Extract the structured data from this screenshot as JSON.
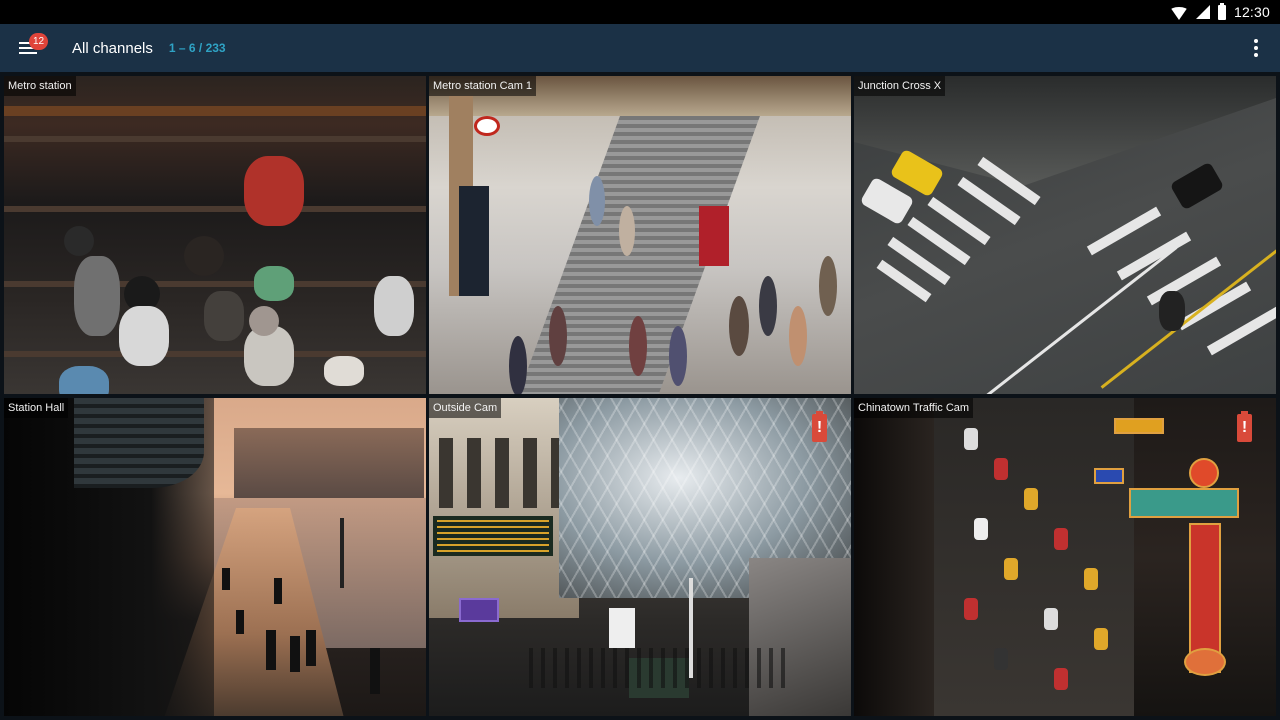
{
  "status_bar": {
    "time": "12:30",
    "icons": [
      "wifi-icon",
      "signal-icon",
      "battery-icon"
    ]
  },
  "app_bar": {
    "menu_badge": "12",
    "title": "All channels",
    "count": "1 – 6 / 233",
    "menu_icon": "hamburger-icon",
    "overflow_icon": "more-vert-icon"
  },
  "channels": [
    {
      "label": "Metro station",
      "low_battery": false
    },
    {
      "label": "Metro station Cam 1",
      "low_battery": false
    },
    {
      "label": "Junction Cross X",
      "low_battery": false
    },
    {
      "label": "Station Hall",
      "low_battery": false
    },
    {
      "label": "Outside Cam",
      "low_battery": true
    },
    {
      "label": "Chinatown Traffic Cam",
      "low_battery": true
    }
  ],
  "low_battery_symbol": "!",
  "colors": {
    "app_bar": "#1b3146",
    "accent": "#2fa3c5",
    "badge": "#e0443a",
    "low_battery": "#d94a3a"
  }
}
